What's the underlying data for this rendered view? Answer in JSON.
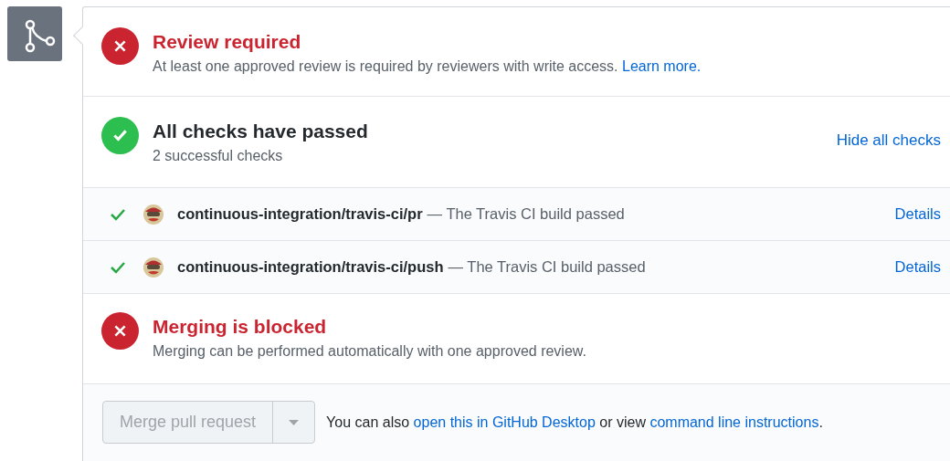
{
  "merge_box": {
    "sections": [
      {
        "kind": "error",
        "title": "Review required",
        "description": "At least one approved review is required by reviewers with write access.",
        "link": "Learn more."
      },
      {
        "kind": "success",
        "title": "All checks have passed",
        "description": "2 successful checks",
        "action": "Hide all checks"
      }
    ],
    "checks": [
      {
        "kind": "success",
        "context": "continuous-integration/travis-ci/pr",
        "description": "— The Travis CI build passed",
        "link": "Details"
      },
      {
        "kind": "success",
        "context": "continuous-integration/travis-ci/push",
        "description": "— The Travis CI build passed",
        "link": "Details"
      }
    ],
    "merge_status": {
      "kind": "error",
      "title": "Merging is blocked",
      "description": "Merging can be performed automatically with one approved review."
    },
    "merge_button": {
      "label": "Merge pull request",
      "disabled": true
    },
    "footer": [
      {
        "kind": "text",
        "text": "You can also"
      },
      {
        "kind": "link",
        "text": "open this in GitHub Desktop"
      },
      {
        "kind": "text",
        "text": "or view"
      },
      {
        "kind": "link",
        "text": "command line instructions"
      },
      {
        "kind": "text",
        "text": "."
      }
    ]
  }
}
